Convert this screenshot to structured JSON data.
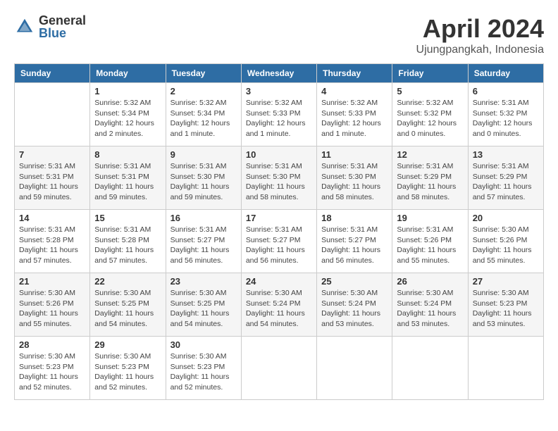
{
  "header": {
    "logo_general": "General",
    "logo_blue": "Blue",
    "month_title": "April 2024",
    "subtitle": "Ujungpangkah, Indonesia"
  },
  "calendar": {
    "weekdays": [
      "Sunday",
      "Monday",
      "Tuesday",
      "Wednesday",
      "Thursday",
      "Friday",
      "Saturday"
    ],
    "weeks": [
      [
        {
          "day": "",
          "info": ""
        },
        {
          "day": "1",
          "info": "Sunrise: 5:32 AM\nSunset: 5:34 PM\nDaylight: 12 hours\nand 2 minutes."
        },
        {
          "day": "2",
          "info": "Sunrise: 5:32 AM\nSunset: 5:34 PM\nDaylight: 12 hours\nand 1 minute."
        },
        {
          "day": "3",
          "info": "Sunrise: 5:32 AM\nSunset: 5:33 PM\nDaylight: 12 hours\nand 1 minute."
        },
        {
          "day": "4",
          "info": "Sunrise: 5:32 AM\nSunset: 5:33 PM\nDaylight: 12 hours\nand 1 minute."
        },
        {
          "day": "5",
          "info": "Sunrise: 5:32 AM\nSunset: 5:32 PM\nDaylight: 12 hours\nand 0 minutes."
        },
        {
          "day": "6",
          "info": "Sunrise: 5:31 AM\nSunset: 5:32 PM\nDaylight: 12 hours\nand 0 minutes."
        }
      ],
      [
        {
          "day": "7",
          "info": "Sunrise: 5:31 AM\nSunset: 5:31 PM\nDaylight: 11 hours\nand 59 minutes."
        },
        {
          "day": "8",
          "info": "Sunrise: 5:31 AM\nSunset: 5:31 PM\nDaylight: 11 hours\nand 59 minutes."
        },
        {
          "day": "9",
          "info": "Sunrise: 5:31 AM\nSunset: 5:30 PM\nDaylight: 11 hours\nand 59 minutes."
        },
        {
          "day": "10",
          "info": "Sunrise: 5:31 AM\nSunset: 5:30 PM\nDaylight: 11 hours\nand 58 minutes."
        },
        {
          "day": "11",
          "info": "Sunrise: 5:31 AM\nSunset: 5:30 PM\nDaylight: 11 hours\nand 58 minutes."
        },
        {
          "day": "12",
          "info": "Sunrise: 5:31 AM\nSunset: 5:29 PM\nDaylight: 11 hours\nand 58 minutes."
        },
        {
          "day": "13",
          "info": "Sunrise: 5:31 AM\nSunset: 5:29 PM\nDaylight: 11 hours\nand 57 minutes."
        }
      ],
      [
        {
          "day": "14",
          "info": "Sunrise: 5:31 AM\nSunset: 5:28 PM\nDaylight: 11 hours\nand 57 minutes."
        },
        {
          "day": "15",
          "info": "Sunrise: 5:31 AM\nSunset: 5:28 PM\nDaylight: 11 hours\nand 57 minutes."
        },
        {
          "day": "16",
          "info": "Sunrise: 5:31 AM\nSunset: 5:27 PM\nDaylight: 11 hours\nand 56 minutes."
        },
        {
          "day": "17",
          "info": "Sunrise: 5:31 AM\nSunset: 5:27 PM\nDaylight: 11 hours\nand 56 minutes."
        },
        {
          "day": "18",
          "info": "Sunrise: 5:31 AM\nSunset: 5:27 PM\nDaylight: 11 hours\nand 56 minutes."
        },
        {
          "day": "19",
          "info": "Sunrise: 5:31 AM\nSunset: 5:26 PM\nDaylight: 11 hours\nand 55 minutes."
        },
        {
          "day": "20",
          "info": "Sunrise: 5:30 AM\nSunset: 5:26 PM\nDaylight: 11 hours\nand 55 minutes."
        }
      ],
      [
        {
          "day": "21",
          "info": "Sunrise: 5:30 AM\nSunset: 5:26 PM\nDaylight: 11 hours\nand 55 minutes."
        },
        {
          "day": "22",
          "info": "Sunrise: 5:30 AM\nSunset: 5:25 PM\nDaylight: 11 hours\nand 54 minutes."
        },
        {
          "day": "23",
          "info": "Sunrise: 5:30 AM\nSunset: 5:25 PM\nDaylight: 11 hours\nand 54 minutes."
        },
        {
          "day": "24",
          "info": "Sunrise: 5:30 AM\nSunset: 5:24 PM\nDaylight: 11 hours\nand 54 minutes."
        },
        {
          "day": "25",
          "info": "Sunrise: 5:30 AM\nSunset: 5:24 PM\nDaylight: 11 hours\nand 53 minutes."
        },
        {
          "day": "26",
          "info": "Sunrise: 5:30 AM\nSunset: 5:24 PM\nDaylight: 11 hours\nand 53 minutes."
        },
        {
          "day": "27",
          "info": "Sunrise: 5:30 AM\nSunset: 5:23 PM\nDaylight: 11 hours\nand 53 minutes."
        }
      ],
      [
        {
          "day": "28",
          "info": "Sunrise: 5:30 AM\nSunset: 5:23 PM\nDaylight: 11 hours\nand 52 minutes."
        },
        {
          "day": "29",
          "info": "Sunrise: 5:30 AM\nSunset: 5:23 PM\nDaylight: 11 hours\nand 52 minutes."
        },
        {
          "day": "30",
          "info": "Sunrise: 5:30 AM\nSunset: 5:23 PM\nDaylight: 11 hours\nand 52 minutes."
        },
        {
          "day": "",
          "info": ""
        },
        {
          "day": "",
          "info": ""
        },
        {
          "day": "",
          "info": ""
        },
        {
          "day": "",
          "info": ""
        }
      ]
    ]
  }
}
